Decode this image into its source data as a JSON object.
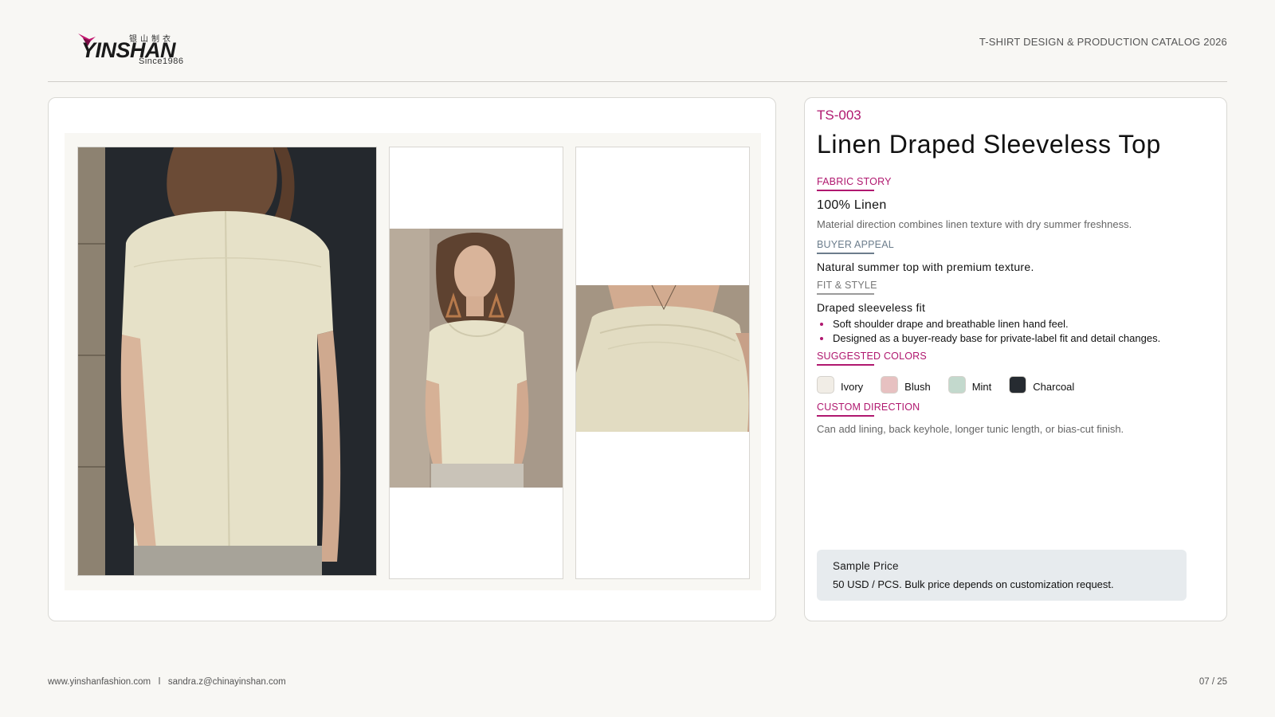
{
  "brand": {
    "chinese_name": "银山制衣",
    "name": "YINSHAN",
    "since": "Since1986",
    "accent_color": "#b0186f"
  },
  "header": {
    "title": "T-SHIRT DESIGN & PRODUCTION CATALOG 2026"
  },
  "product": {
    "code": "TS-003",
    "title": "Linen Draped Sleeveless Top",
    "fabric_story": {
      "label": "FABRIC STORY",
      "main": "100% Linen",
      "detail": "Material direction combines linen texture with dry summer freshness."
    },
    "buyer_appeal": {
      "label": "BUYER APPEAL",
      "text": "Natural summer top with premium texture."
    },
    "fit_style": {
      "label": "FIT & STYLE",
      "main": "Draped sleeveless fit",
      "bullets": [
        "Soft shoulder drape and breathable linen hand feel.",
        "Designed as a buyer-ready base for private-label fit and detail changes."
      ]
    },
    "suggested_colors": {
      "label": "SUGGESTED COLORS",
      "colors": [
        {
          "name": "Ivory",
          "hex": "#f1ede6"
        },
        {
          "name": "Blush",
          "hex": "#e7c1c1"
        },
        {
          "name": "Mint",
          "hex": "#c3d9cd"
        },
        {
          "name": "Charcoal",
          "hex": "#262b31"
        }
      ]
    },
    "custom_direction": {
      "label": "CUSTOM DIRECTION",
      "text": "Can add lining, back keyhole, longer tunic length, or bias-cut finish."
    },
    "price": {
      "label": "Sample Price",
      "text": "50 USD / PCS. Bulk price depends on customization request."
    }
  },
  "footer": {
    "contact": "www.yinshanfashion.com   l   sandra.z@chinayinshan.com",
    "page": "07 / 25"
  }
}
